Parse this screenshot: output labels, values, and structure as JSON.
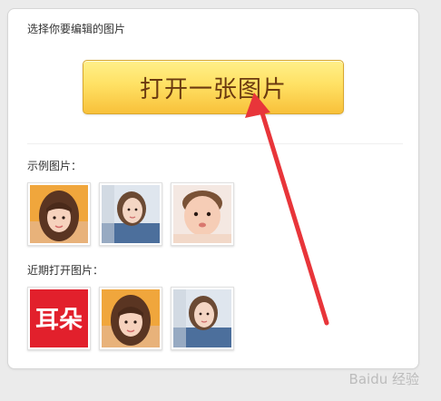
{
  "instruction": "选择你要编辑的图片",
  "open_button_label": "打开一张图片",
  "examples_label": "示例图片：",
  "recent_label": "近期打开图片：",
  "example_thumbnails": [
    {
      "name": "example-photo-girl-bangs"
    },
    {
      "name": "example-photo-girl-denim"
    },
    {
      "name": "example-photo-baby"
    }
  ],
  "recent_thumbnails": [
    {
      "name": "recent-photo-red-text",
      "text": "耳朵"
    },
    {
      "name": "recent-photo-girl-bangs"
    },
    {
      "name": "recent-photo-girl-denim"
    }
  ],
  "colors": {
    "button_top": "#fff08a",
    "button_bottom": "#f8c13a",
    "button_text": "#6b3a10",
    "annotation_arrow": "#e8353a"
  },
  "watermark": "Baidu 经验"
}
